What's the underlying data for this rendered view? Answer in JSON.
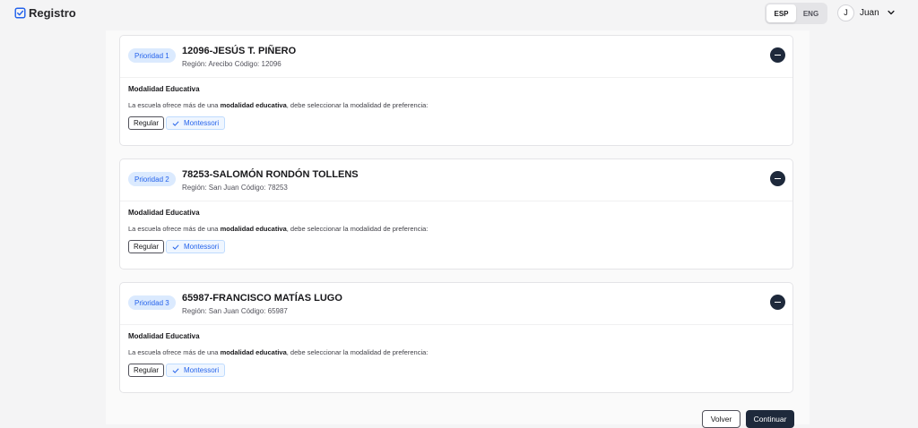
{
  "app": {
    "logo_text": "Registro"
  },
  "header": {
    "languages": [
      {
        "label": "ESP",
        "active": true
      },
      {
        "label": "ENG",
        "active": false
      }
    ],
    "user": {
      "initial": "J",
      "name": "Juan"
    }
  },
  "schools": [
    {
      "priority": "Prioridad 1",
      "name": "12096-JESÚS T. PIÑERO",
      "meta": "Región: Arecibo Código: 12096",
      "modality_title": "Modalidad Educativa",
      "desc_pre": "La escuela ofrece más de una ",
      "desc_bold": "modalidad educativa",
      "desc_post": ", debe seleccionar la modalidad de preferencia:",
      "options": [
        "Regular",
        "Montessori"
      ]
    },
    {
      "priority": "Prioridad 2",
      "name": "78253-SALOMÓN RONDÓN TOLLENS",
      "meta": "Región: San Juan Código: 78253",
      "modality_title": "Modalidad Educativa",
      "desc_pre": "La escuela ofrece más de una ",
      "desc_bold": "modalidad educativa",
      "desc_post": ", debe seleccionar la modalidad de preferencia:",
      "options": [
        "Regular",
        "Montessori"
      ]
    },
    {
      "priority": "Prioridad 3",
      "name": "65987-FRANCISCO MATÍAS LUGO",
      "meta": "Región: San Juan Código: 65987",
      "modality_title": "Modalidad Educativa",
      "desc_pre": "La escuela ofrece más de una ",
      "desc_bold": "modalidad educativa",
      "desc_post": ", debe seleccionar la modalidad de preferencia:",
      "options": [
        "Regular",
        "Montessori"
      ]
    }
  ],
  "footer": {
    "back_label": "Volver",
    "continue_label": "Continuar"
  },
  "colors": {
    "accent": "#2563eb",
    "dark": "#1e293b",
    "badge_bg": "#dbeafe"
  },
  "icons": {
    "logo": "check-square-icon",
    "user_menu": "chevron-down-icon",
    "remove": "minus-circle-icon",
    "selected": "check-icon"
  }
}
